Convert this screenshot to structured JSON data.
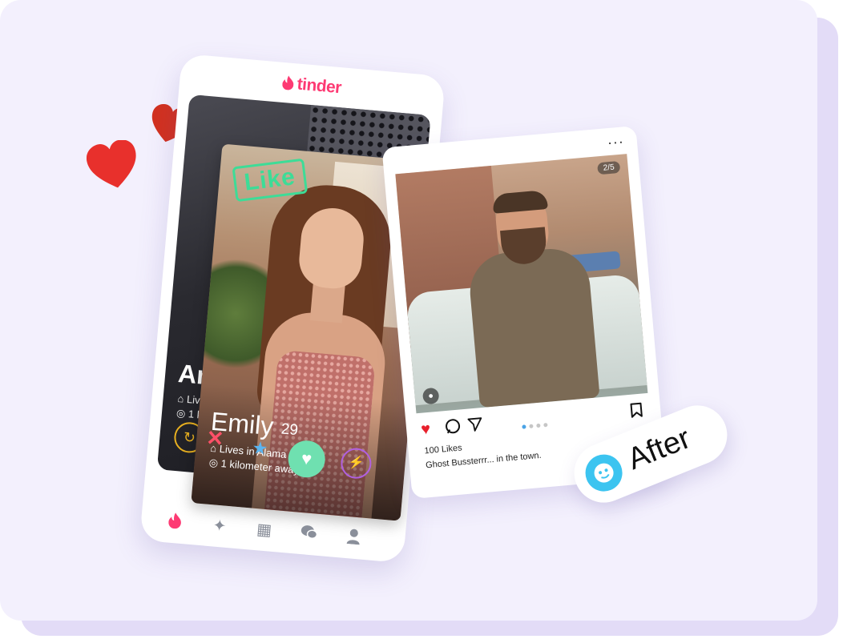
{
  "tinder": {
    "logo": "tinder",
    "back_profile": {
      "name": "Ana",
      "lives": "Lives i",
      "distance": "1 kilom"
    },
    "stamp": "Like",
    "front_profile": {
      "name": "Emily",
      "age": "29",
      "lives": "Lives in Alama",
      "distance": "1 kilometer away"
    },
    "nav": [
      "flame-icon",
      "sparkle-icon",
      "explore-icon",
      "chat-icon",
      "profile-icon"
    ]
  },
  "post": {
    "more": "···",
    "counter": "2/5",
    "likes": "100 Likes",
    "caption": "Ghost Bussterrr... in the town."
  },
  "badge": {
    "label": "After"
  },
  "colors": {
    "tinder": "#fd3a73",
    "like": "#3ddc97",
    "heart": "#e8302c",
    "bg": "#f3f0fd",
    "after_logo": "#3cc4f0"
  }
}
